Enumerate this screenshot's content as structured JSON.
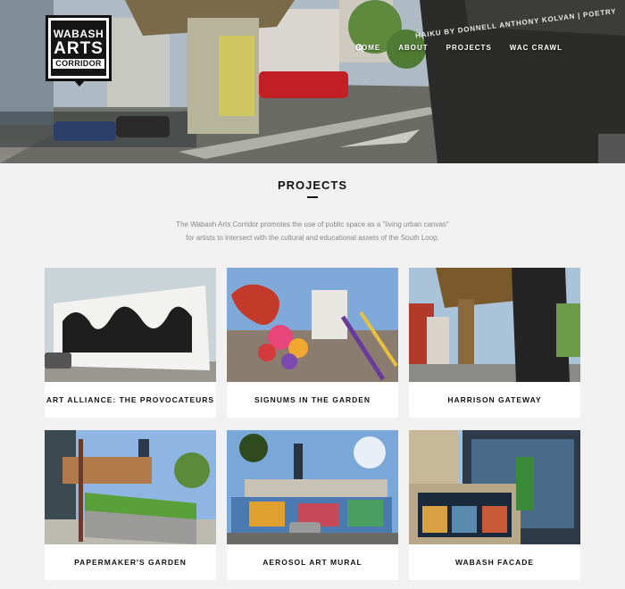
{
  "logo": {
    "line1": "WABASH",
    "line2": "ARTS",
    "line3": "CORRIDOR"
  },
  "nav": {
    "items": [
      {
        "label": "HOME"
      },
      {
        "label": "ABOUT"
      },
      {
        "label": "PROJECTS"
      },
      {
        "label": "WAC CRAWL"
      }
    ],
    "search_icon": "search-icon"
  },
  "hero": {
    "pillar_text": "HAIKU BY DONNELL ANTHONY KOLVAN | POETRY"
  },
  "section": {
    "title": "PROJECTS",
    "intro_line1": "The Wabash Arts Corridor promotes the use of public space as a \"living urban canvas\"",
    "intro_line2": "for artists to intersect with the cultural and educational assets of the South Loop."
  },
  "projects": [
    {
      "title": "ART ALLIANCE: THE PROVOCATEURS"
    },
    {
      "title": "SIGNUMS IN THE GARDEN"
    },
    {
      "title": "HARRISON GATEWAY"
    },
    {
      "title": "PAPERMAKER'S GARDEN"
    },
    {
      "title": "AEROSOL ART MURAL"
    },
    {
      "title": "WABASH FACADE"
    }
  ],
  "colors": {
    "background": "#f1f1f1",
    "card": "#ffffff",
    "text": "#111111",
    "muted": "#888888"
  }
}
